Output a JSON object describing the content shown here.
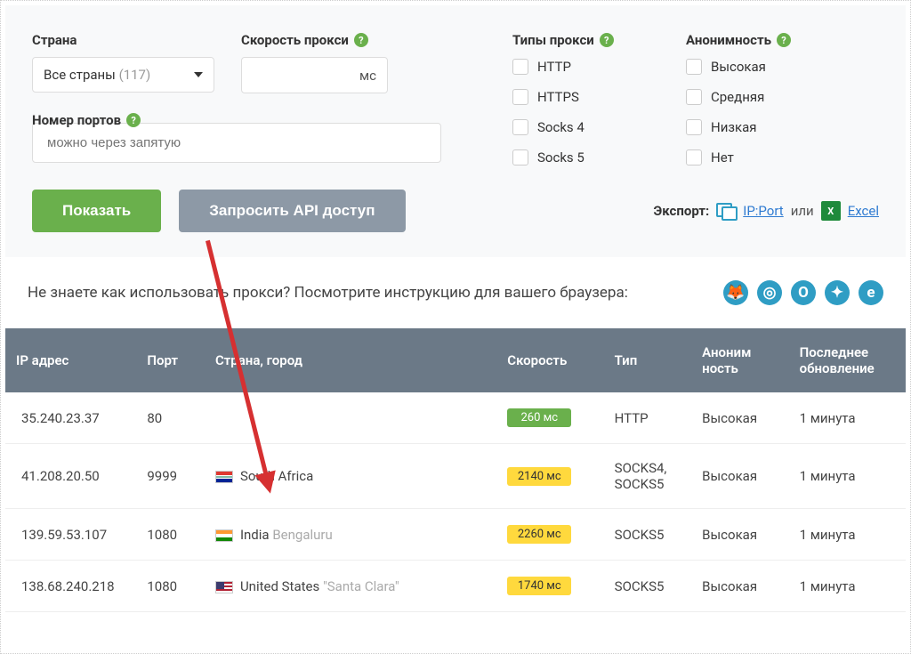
{
  "filters": {
    "country_label": "Страна",
    "country_value": "Все страны",
    "country_count": "(117)",
    "speed_label": "Скорость прокси",
    "speed_unit": "мс",
    "ports_label": "Номер портов",
    "ports_placeholder": "можно через запятую",
    "types_label": "Типы прокси",
    "types": [
      "HTTP",
      "HTTPS",
      "Socks 4",
      "Socks 5"
    ],
    "anon_label": "Анонимность",
    "anon": [
      "Высокая",
      "Средняя",
      "Низкая",
      "Нет"
    ]
  },
  "actions": {
    "show": "Показать",
    "api": "Запросить API доступ",
    "export_label": "Экспорт:",
    "ip_port": "IP:Port",
    "or": "или",
    "excel": "Excel",
    "excel_icon": "X"
  },
  "instruction": "Не знаете как использовать прокси? Посмотрите инструкцию для вашего браузера:",
  "table": {
    "headers": {
      "ip": "IP адрес",
      "port": "Порт",
      "location": "Страна, город",
      "speed": "Скорость",
      "type": "Тип",
      "anon": "Аноним ность",
      "updated": "Последнее обновление"
    },
    "rows": [
      {
        "ip": "35.240.23.37",
        "port": "80",
        "flag": "",
        "country": "",
        "city": "",
        "speed": "260 мс",
        "speed_class": "sb-green",
        "type": "HTTP",
        "anon": "Высокая",
        "updated": "1 минута"
      },
      {
        "ip": "41.208.20.50",
        "port": "9999",
        "flag": "flag-za",
        "country": "South Africa",
        "city": "",
        "speed": "2140 мс",
        "speed_class": "sb-yellow",
        "type": "SOCKS4, SOCKS5",
        "anon": "Высокая",
        "updated": "1 минута"
      },
      {
        "ip": "139.59.53.107",
        "port": "1080",
        "flag": "flag-in",
        "country": "India",
        "city": "Bengaluru",
        "speed": "2260 мс",
        "speed_class": "sb-yellow",
        "type": "SOCKS5",
        "anon": "Высокая",
        "updated": "1 минута"
      },
      {
        "ip": "138.68.240.218",
        "port": "1080",
        "flag": "flag-us",
        "country": "United States",
        "city": "\"Santa Clara\"",
        "speed": "1740 мс",
        "speed_class": "sb-yellow",
        "type": "SOCKS5",
        "anon": "Высокая",
        "updated": "1 минута"
      }
    ]
  }
}
